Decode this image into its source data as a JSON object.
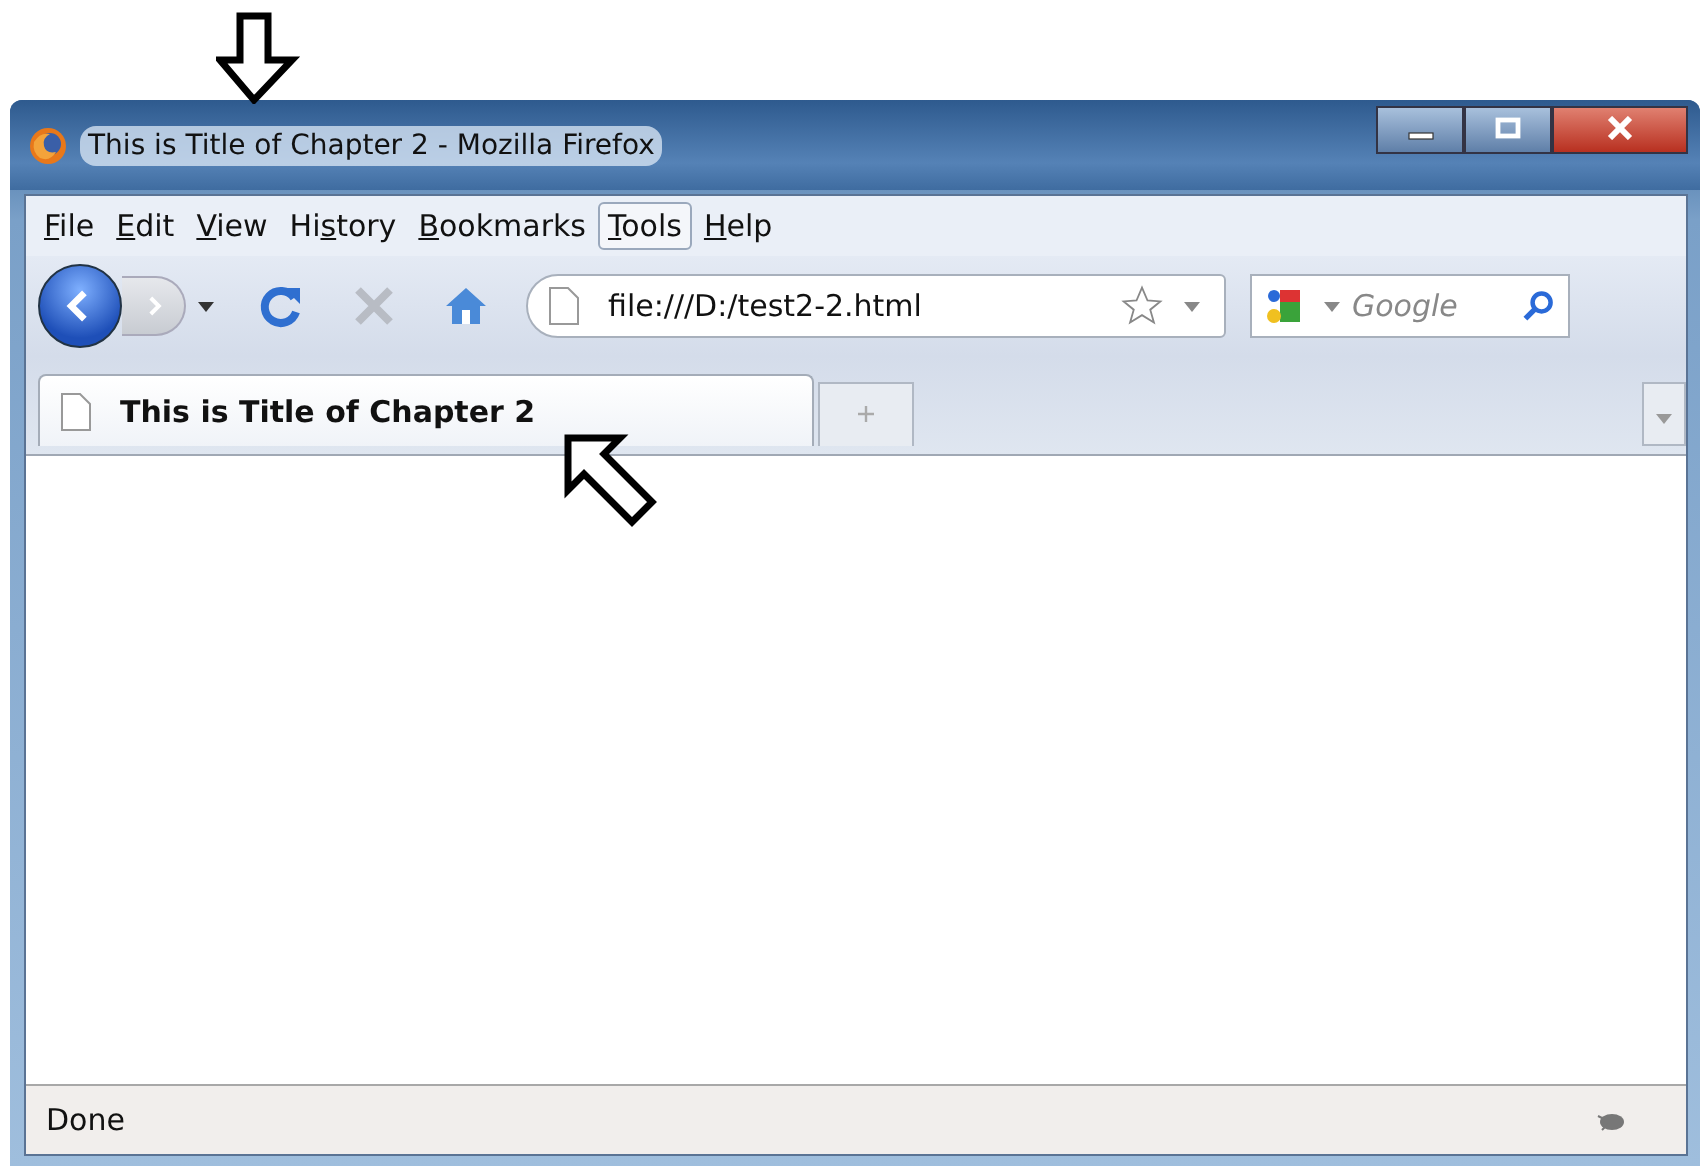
{
  "window": {
    "title": "This is Title of Chapter 2 - Mozilla Firefox"
  },
  "menu": [
    {
      "key": "F",
      "after": "ile",
      "hovered": false
    },
    {
      "key": "E",
      "after": "dit",
      "hovered": false
    },
    {
      "key": "V",
      "after": "iew",
      "hovered": false
    },
    {
      "before": "Hi",
      "key": "s",
      "after": "tory",
      "hovered": false
    },
    {
      "key": "B",
      "after": "ookmarks",
      "hovered": false
    },
    {
      "key": "T",
      "after": "ools",
      "hovered": true
    },
    {
      "key": "H",
      "after": "elp",
      "hovered": false
    }
  ],
  "navigation": {
    "back_disabled": false,
    "forward_disabled": true,
    "stop_disabled": true,
    "address": "file:///D:/test2-2.html",
    "search_placeholder": "Google"
  },
  "tabs": [
    {
      "label": "This is Title of Chapter 2",
      "selected": true
    }
  ],
  "status_bar": {
    "text": "Done"
  }
}
